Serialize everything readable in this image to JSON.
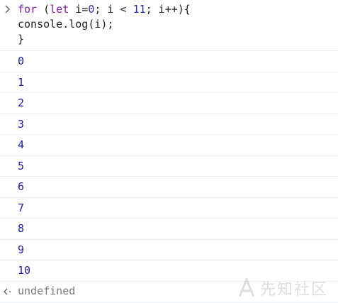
{
  "console": {
    "input": {
      "lines": [
        [
          {
            "t": "for",
            "c": "kw"
          },
          {
            "t": " (",
            "c": "plain"
          },
          {
            "t": "let",
            "c": "kw"
          },
          {
            "t": " i=",
            "c": "plain"
          },
          {
            "t": "0",
            "c": "num"
          },
          {
            "t": "; i < ",
            "c": "plain"
          },
          {
            "t": "11",
            "c": "num"
          },
          {
            "t": "; i++){",
            "c": "plain"
          }
        ],
        [
          {
            "t": "console.log(i);",
            "c": "plain"
          }
        ],
        [
          {
            "t": "}",
            "c": "plain"
          }
        ]
      ]
    },
    "outputs": [
      "0",
      "1",
      "2",
      "3",
      "4",
      "5",
      "6",
      "7",
      "8",
      "9",
      "10"
    ],
    "result": "undefined"
  },
  "watermark": {
    "text": "先知社区"
  },
  "colors": {
    "keyword": "#8a1ca8",
    "number": "#2b2bb8",
    "output_number": "#1a1aa6",
    "result_gray": "#7a7a7a",
    "divider": "#eceff3"
  }
}
